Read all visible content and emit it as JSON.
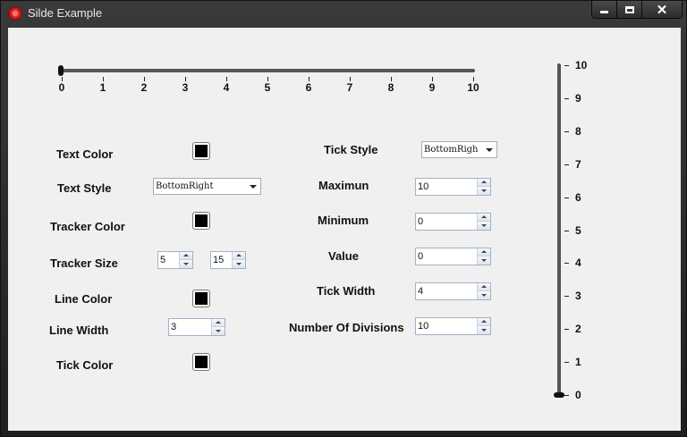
{
  "window": {
    "title": "Silde Example"
  },
  "hslider": {
    "ticks": [
      "0",
      "1",
      "2",
      "3",
      "4",
      "5",
      "6",
      "7",
      "8",
      "9",
      "10"
    ],
    "value": 0
  },
  "vslider": {
    "ticks": [
      "10",
      "9",
      "8",
      "7",
      "6",
      "5",
      "4",
      "3",
      "2",
      "1",
      "0"
    ],
    "value": 0
  },
  "left_panel": {
    "text_color_label": "Text Color",
    "text_style_label": "Text Style",
    "text_style_value": "BottomRight",
    "tracker_color_label": "Tracker Color",
    "tracker_size_label": "Tracker Size",
    "tracker_size_w": "5",
    "tracker_size_h": "15",
    "line_color_label": "Line Color",
    "line_width_label": "Line Width",
    "line_width_value": "3",
    "tick_color_label": "Tick Color"
  },
  "right_panel": {
    "tick_style_label": "Tick Style",
    "tick_style_value": "BottomRigh",
    "maximum_label": "Maximun",
    "maximum_value": "10",
    "minimum_label": "Minimum",
    "minimum_value": "0",
    "value_label": "Value",
    "value_value": "0",
    "tick_width_label": "Tick Width",
    "tick_width_value": "4",
    "divisions_label": "Number Of Divisions",
    "divisions_value": "10"
  },
  "colors": {
    "swatch": "#000000"
  }
}
